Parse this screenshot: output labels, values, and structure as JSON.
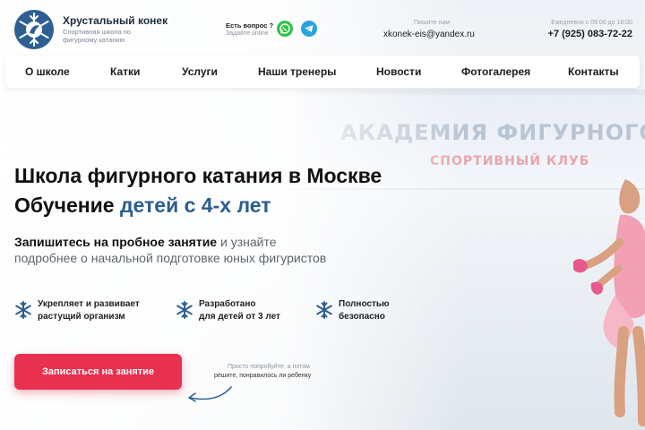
{
  "brand": {
    "title": "Хрустальный конек",
    "subtitle": "Спортивная школа по фигурному катанию",
    "logo_icon": "snowflake-logo-icon"
  },
  "contact": {
    "question": "Есть вопрос ?",
    "question_sub": "Задайте online",
    "whatsapp_icon": "whatsapp-icon",
    "telegram_icon": "telegram-icon",
    "email_caption": "Пишите нам",
    "email": "xkonek-eis@yandex.ru",
    "hours": "Ежедневно с 09:00 до 18:00",
    "phone": "+7 (925) 083-72-22"
  },
  "nav": {
    "items": [
      {
        "label": "О школе"
      },
      {
        "label": "Катки"
      },
      {
        "label": "Услуги"
      },
      {
        "label": "Наши тренеры"
      },
      {
        "label": "Новости"
      },
      {
        "label": "Фотогалерея"
      },
      {
        "label": "Контакты"
      }
    ]
  },
  "hero": {
    "title_line1": "Школа фигурного катания в Москве",
    "title_line2_prefix": "Обучение",
    "title_line2_accent": "детей с 4-х лет",
    "lead_bold": "Запишитесь на пробное занятие",
    "lead_rest": "и узнайте",
    "lead_line2": "подробнее о начальной подготовке юных фигуристов",
    "background_text": "АКАДЕМИЯ ФИГУРНОГО КАТАНИЯ",
    "background_subtext": "СПОРТИВНЫЙ КЛУБ"
  },
  "features": [
    {
      "line1": "Укрепляет и развивает",
      "line2": "растущий организм",
      "icon": "snowflake-icon"
    },
    {
      "line1": "Разработано",
      "line2": "для детей от 3 лет",
      "icon": "snowflake-icon"
    },
    {
      "line1": "Полностью",
      "line2": "безопасно",
      "icon": "snowflake-icon"
    }
  ],
  "cta": {
    "label": "Записаться на занятие",
    "hint_line1": "Просто попробуйте, а потом",
    "hint_line2": "решите, понравилось ли ребенку"
  },
  "colors": {
    "accent_blue": "#2c5d8f",
    "cta_red": "#e8304f",
    "whatsapp": "#31c34a",
    "telegram": "#2aa3dd"
  }
}
